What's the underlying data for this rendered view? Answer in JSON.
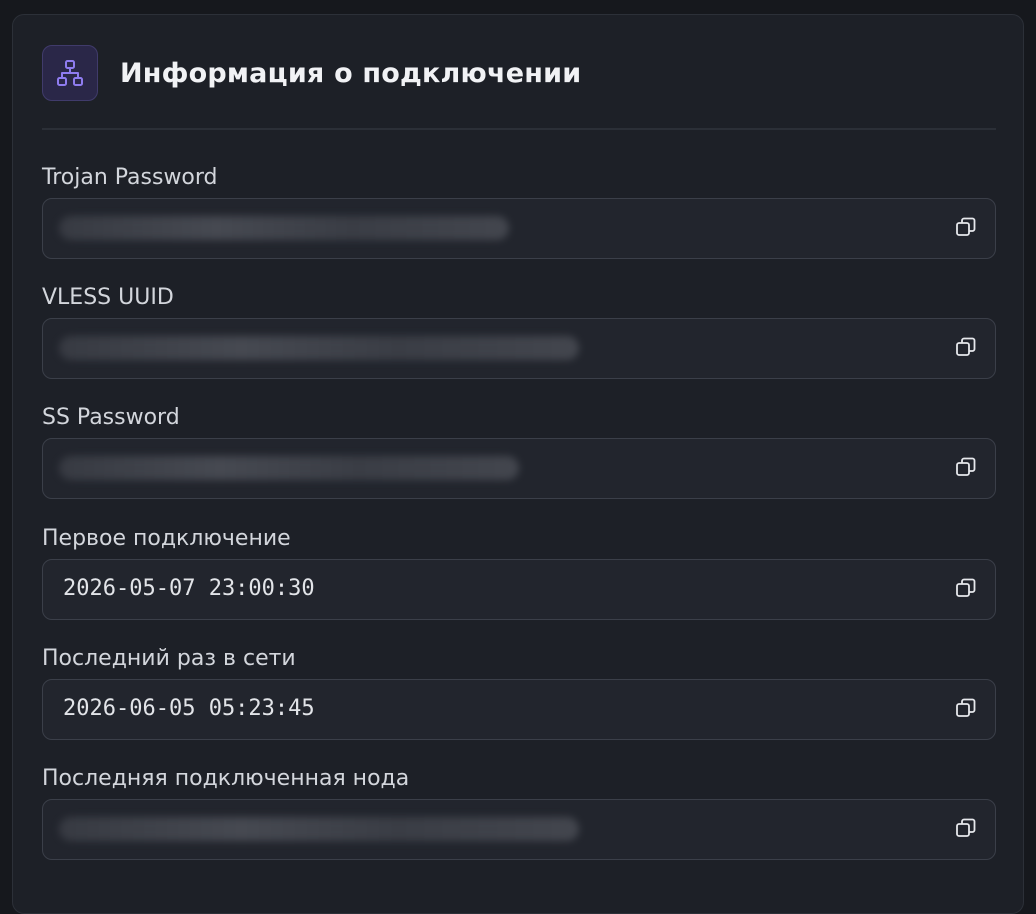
{
  "header": {
    "title": "Информация о подключении",
    "icon": "network-icon",
    "icon_color": "#8f7cf0"
  },
  "fields": [
    {
      "label": "Trojan Password",
      "value": "",
      "masked": true
    },
    {
      "label": "VLESS UUID",
      "value": "",
      "masked": true
    },
    {
      "label": "SS Password",
      "value": "",
      "masked": true
    },
    {
      "label": "Первое подключение",
      "value": "2026-05-07 23:00:30",
      "masked": false
    },
    {
      "label": "Последний раз в сети",
      "value": "2026-06-05 05:23:45",
      "masked": false
    },
    {
      "label": "Последняя подключенная нода",
      "value": "",
      "masked": true
    }
  ],
  "copy_icon": "copy-icon"
}
